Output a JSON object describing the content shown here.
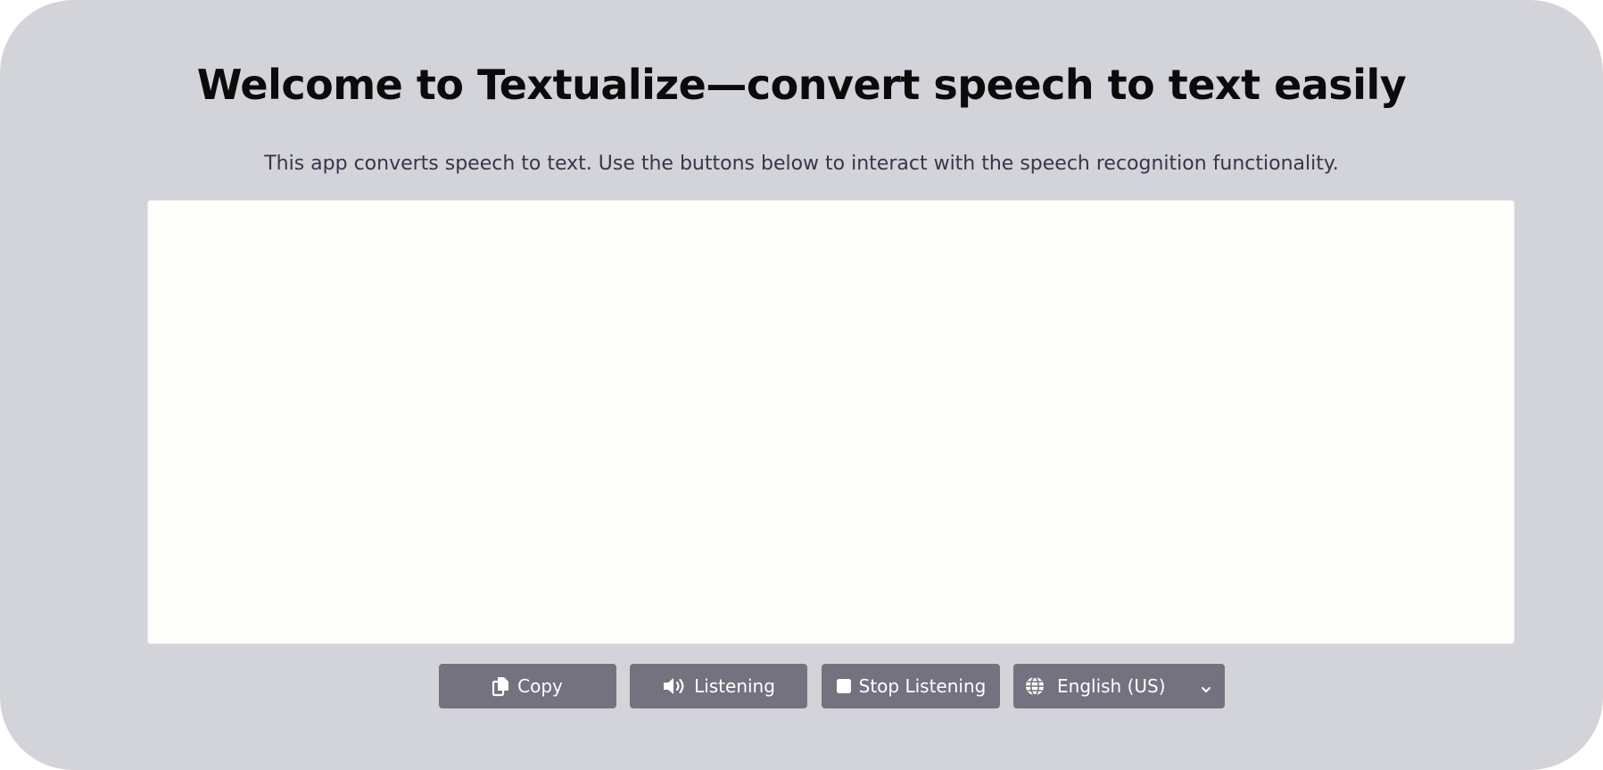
{
  "header": {
    "title": "Welcome to Textualize—convert speech to text easily",
    "subtitle": "This app converts speech to text. Use the buttons below to interact with the speech recognition functionality."
  },
  "transcript": {
    "value": "",
    "placeholder": ""
  },
  "controls": {
    "copy": {
      "label": "Copy",
      "icon": "copy-icon"
    },
    "listen": {
      "label": "Listening",
      "icon": "speaker-icon"
    },
    "stop": {
      "label": "Stop Listening",
      "icon": "stop-icon"
    },
    "language": {
      "selected": "English (US)",
      "icon": "globe-icon"
    }
  },
  "colors": {
    "background": "#d3d3da",
    "button": "#74727f",
    "textarea": "#fdfdfa",
    "title": "#0b0b0b",
    "subtitle": "#37354a"
  }
}
